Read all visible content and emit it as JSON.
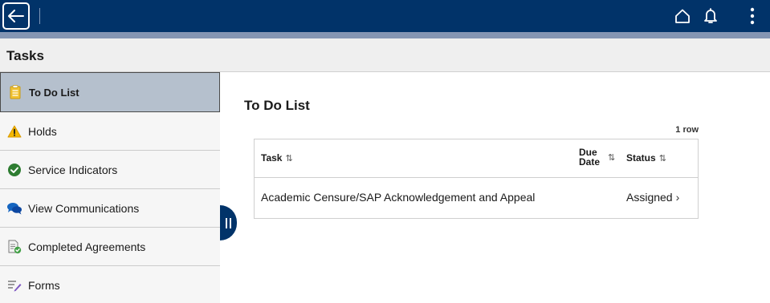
{
  "header": {
    "back_icon": "back-arrow-icon",
    "home_icon": "home-icon",
    "notifications_icon": "bell-icon",
    "menu_icon": "kebab-menu-icon"
  },
  "page": {
    "title": "Tasks"
  },
  "sidebar": {
    "items": [
      {
        "label": "To Do List",
        "icon": "clipboard-icon",
        "selected": true
      },
      {
        "label": "Holds",
        "icon": "warning-icon",
        "selected": false
      },
      {
        "label": "Service Indicators",
        "icon": "check-circle-icon",
        "selected": false
      },
      {
        "label": "View Communications",
        "icon": "chat-bubbles-icon",
        "selected": false
      },
      {
        "label": "Completed Agreements",
        "icon": "document-check-icon",
        "selected": false
      },
      {
        "label": "Forms",
        "icon": "form-pencil-icon",
        "selected": false
      }
    ]
  },
  "main": {
    "title": "To Do List",
    "row_count": "1 row",
    "columns": {
      "task": "Task",
      "due_date": "Due Date",
      "status": "Status"
    },
    "rows": [
      {
        "task": "Academic Censure/SAP Acknowledgement and Appeal",
        "due_date": "",
        "status": "Assigned"
      }
    ],
    "sort_glyph": "⇅",
    "chevron": "›"
  },
  "colors": {
    "banner": "#013369",
    "banner_stripe": "#8596b3",
    "selected_nav": "#b5c0cd"
  }
}
